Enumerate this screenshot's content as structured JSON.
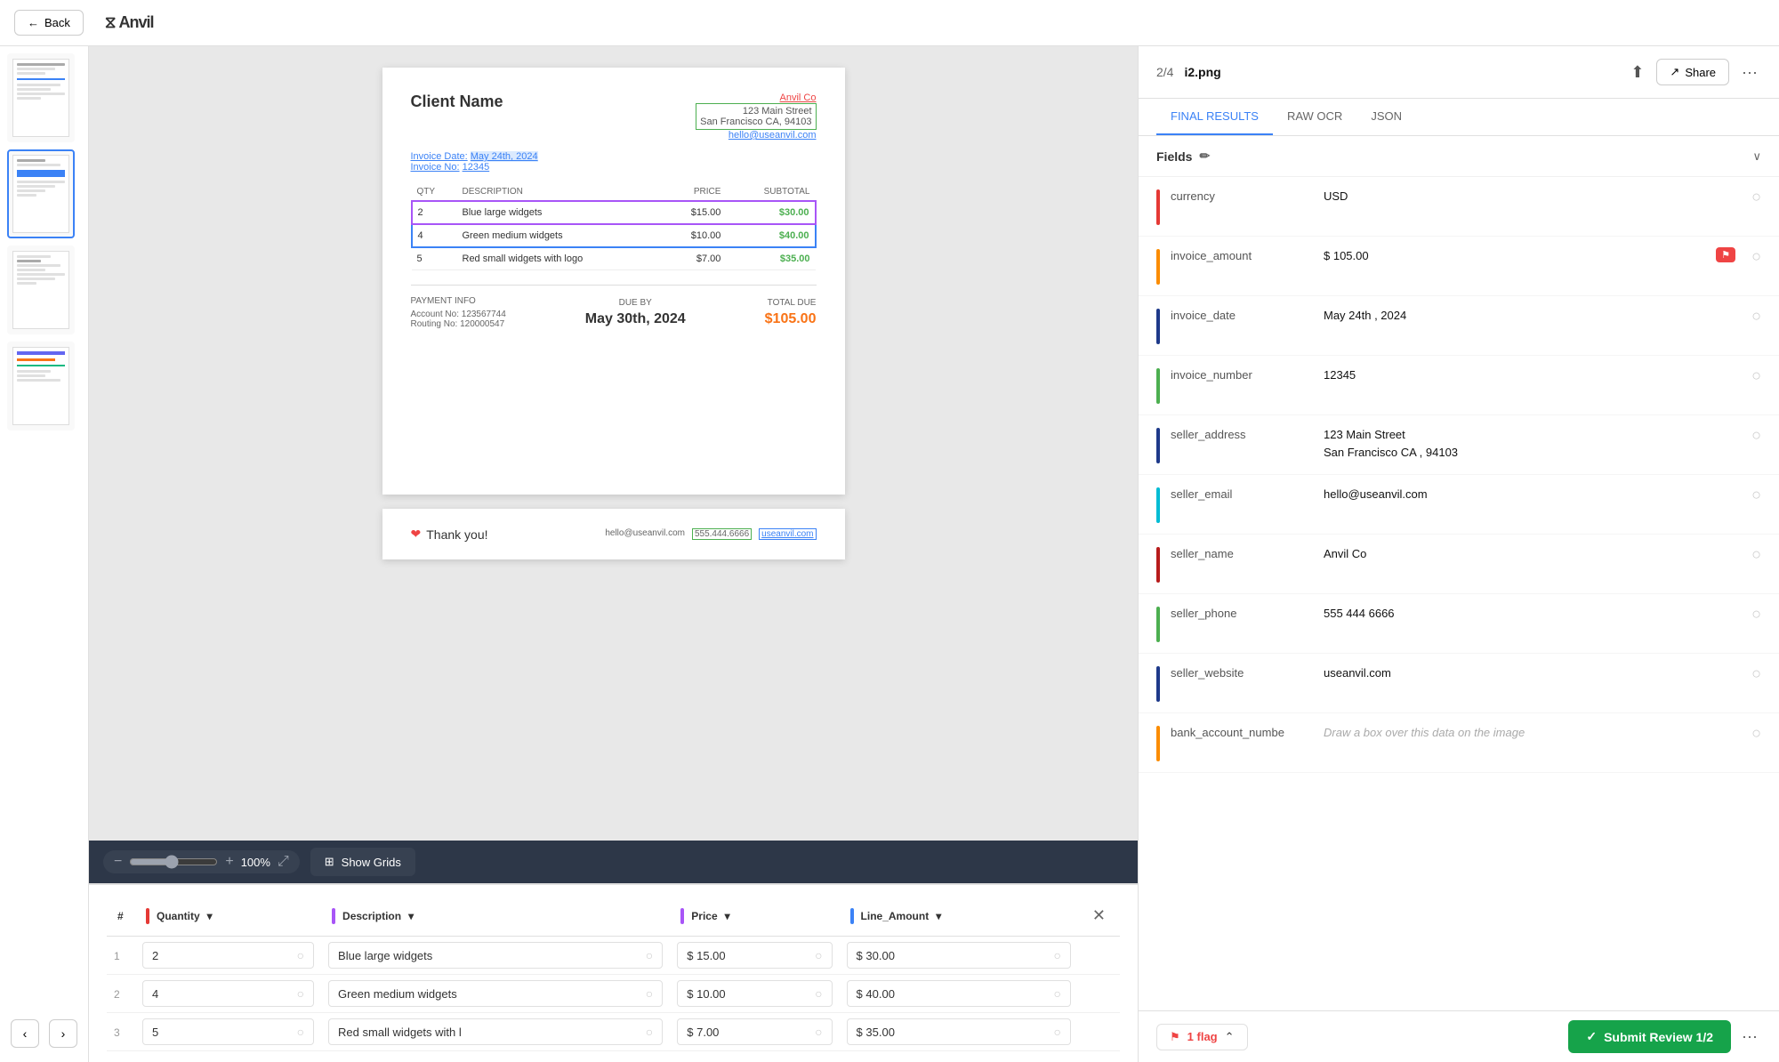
{
  "header": {
    "back_label": "Back",
    "logo": "Anvil"
  },
  "file_info": {
    "page": "2/4",
    "filename": "i2.png"
  },
  "toolbar_buttons": {
    "share": "Share",
    "more": "···"
  },
  "tabs": [
    "FINAL RESULTS",
    "RAW OCR",
    "JSON"
  ],
  "active_tab": "FINAL RESULTS",
  "fields_header": {
    "title": "Fields",
    "edit_icon": "✏",
    "chevron": "∨"
  },
  "fields": [
    {
      "name": "currency",
      "value": "USD",
      "color": "#e53935",
      "flag": false,
      "check": true
    },
    {
      "name": "invoice_amount",
      "value": "$ 105.00",
      "color": "#fb8c00",
      "flag": true,
      "check": true
    },
    {
      "name": "invoice_date",
      "value": "May 24th , 2024",
      "color": "#1e3a8a",
      "flag": false,
      "check": true
    },
    {
      "name": "invoice_number",
      "value": "12345",
      "color": "#4caf50",
      "flag": false,
      "check": true
    },
    {
      "name": "seller_address",
      "value": "123 Main Street\nSan Francisco CA , 94103",
      "color": "#1e3a8a",
      "flag": false,
      "check": true
    },
    {
      "name": "seller_email",
      "value": "hello@useanvil.com",
      "color": "#00bcd4",
      "flag": false,
      "check": true
    },
    {
      "name": "seller_name",
      "value": "Anvil Co",
      "color": "#b71c1c",
      "flag": false,
      "check": true
    },
    {
      "name": "seller_phone",
      "value": "555 444 6666",
      "color": "#4caf50",
      "flag": false,
      "check": true
    },
    {
      "name": "seller_website",
      "value": "useanvil.com",
      "color": "#1e3a8a",
      "flag": false,
      "check": true
    },
    {
      "name": "bank_account_numbe",
      "value": "Draw a box over this data on the image",
      "color": "#fb8c00",
      "flag": false,
      "check": false
    }
  ],
  "flags": {
    "count": 1,
    "label": "1 flag"
  },
  "submit_btn": "Submit Review 1/2",
  "zoom": {
    "level": "100%"
  },
  "show_grids": "Show Grids",
  "grid_columns": [
    {
      "label": "Quantity",
      "color": "#e53935"
    },
    {
      "label": "Description",
      "color": "#a855f7"
    },
    {
      "label": "Price",
      "color": "#a855f7"
    },
    {
      "label": "Line_Amount",
      "color": "#3b82f6"
    }
  ],
  "grid_rows": [
    {
      "num": 1,
      "qty": "2",
      "desc": "Blue large widgets",
      "price": "$ 15.00",
      "amount": "$ 30.00"
    },
    {
      "num": 2,
      "qty": "4",
      "desc": "Green medium widgets",
      "price": "$ 10.00",
      "amount": "$ 40.00"
    },
    {
      "num": 3,
      "qty": "5",
      "desc": "Red small widgets with l",
      "price": "$ 7.00",
      "amount": "$ 35.00"
    }
  ],
  "doc": {
    "client_name": "Client Name",
    "seller_name_doc": "Anvil Co",
    "address_line1": "123 Main Street",
    "address_line2": "San Francisco CA, 94103",
    "email": "hello@useanvil.com",
    "invoice_date_label": "Invoice Date:",
    "invoice_date_val": "May 24th, 2024",
    "invoice_no_label": "Invoice No:",
    "invoice_no_val": "12345",
    "table_headers": [
      "QTY",
      "DESCRIPTION",
      "PRICE",
      "SUBTOTAL"
    ],
    "table_rows": [
      {
        "qty": "2",
        "desc": "Blue large widgets",
        "price": "$15.00",
        "subtotal": "$30.00"
      },
      {
        "qty": "4",
        "desc": "Green medium widgets",
        "price": "$10.00",
        "subtotal": "$40.00"
      },
      {
        "qty": "5",
        "desc": "Red small widgets with logo",
        "price": "$7.00",
        "subtotal": "$35.00"
      }
    ],
    "payment_info_label": "PAYMENT INFO",
    "due_by_label": "DUE BY",
    "total_due_label": "TOTAL DUE",
    "account_no": "Account No: 123567744",
    "routing_no": "Routing No: 120000547",
    "due_date": "May 30th, 2024",
    "total_amount": "$105.00",
    "thank_you": "Thank you!",
    "footer_email": "hello@useanvil.com",
    "footer_phone": "555.444.6666",
    "footer_url": "useanvil.com"
  }
}
